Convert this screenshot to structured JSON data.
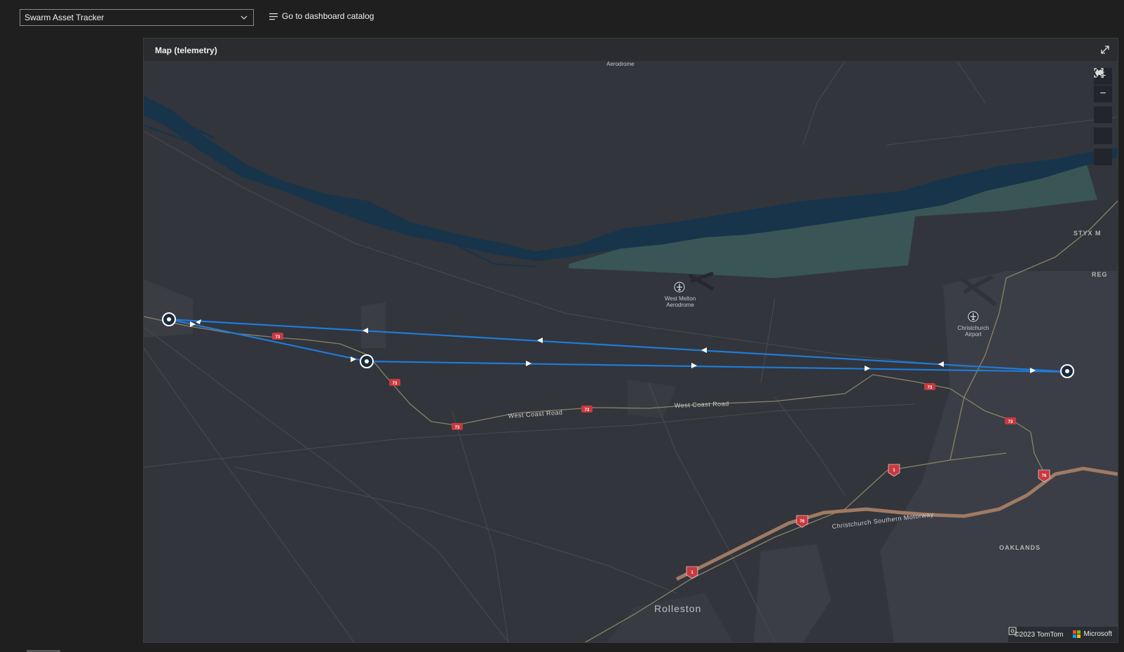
{
  "topbar": {
    "dashboard_select_value": "Swarm Asset Tracker",
    "catalog_link_label": "Go to dashboard catalog"
  },
  "tile": {
    "title": "Map (telemetry)"
  },
  "map": {
    "labels": {
      "aerodrome_top": "Aerodrome",
      "west_melton": "West Melton\nAerodrome",
      "christchurch_airport": "Christchurch\nAirport",
      "styx": "STYX M",
      "reg": "REG",
      "oaklands": "OAKLANDS",
      "rolleston": "Rolleston",
      "west_coast_road_1": "West Coast Road",
      "west_coast_road_2": "West Coast Road",
      "motorway": "Christchurch Southern Motorway"
    },
    "route_shields": [
      "73",
      "73",
      "73",
      "73",
      "73",
      "73",
      "1",
      "1",
      "76",
      "76"
    ],
    "track_color": "#1f7bd8",
    "attribution": "©2023 TomTom",
    "microsoft_label": "Microsoft"
  },
  "controls": {
    "zoom_in": "+",
    "zoom_out": "−"
  }
}
